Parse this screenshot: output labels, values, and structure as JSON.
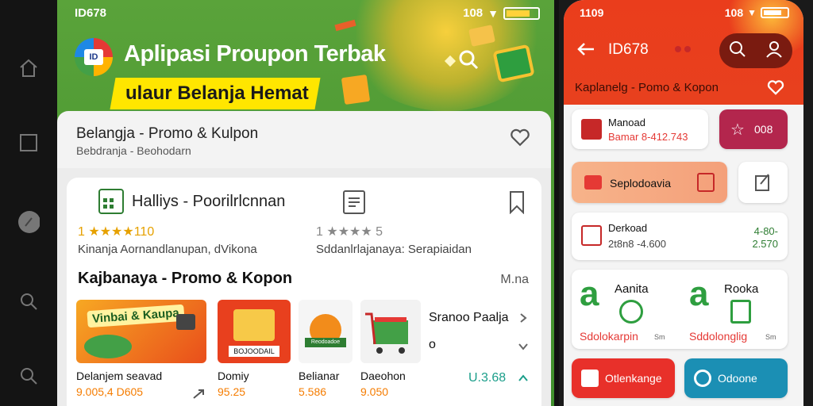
{
  "colors": {
    "green": "#4a9a33",
    "yellow": "#ffe600",
    "red": "#e8401e",
    "orange": "#f57c00",
    "teal": "#1b9e8a"
  },
  "rail": {
    "icons": [
      "home-icon",
      "square-icon",
      "circle-icon",
      "search-icon",
      "search-icon"
    ]
  },
  "phone1": {
    "status_left": "ID678",
    "status_right": "108",
    "title": "Aplipasi Proupon Terbak",
    "banner": "ulaur Belanja Hemat",
    "card": {
      "title": "Belangja - Promo & Kulpon",
      "subtitle": "Bebdranja - Beohodarn"
    },
    "row_title": "Halliys - Poorilrlcnnan",
    "rating_left": "1 ★★★★110",
    "rating_right": "1 ★★★★ 5",
    "sub_left": "Kinanja Aornandlanupan, dVikona",
    "sub_right": "Sddanlrlajanaya: Serapiaidan",
    "section_title": "Kajbanaya - Promo & Kopon",
    "section_more": "M.na",
    "products": [
      {
        "name": "Delanjem seavad",
        "price": "9.005,4 D605",
        "img_text": "Vinbai & Kaupa"
      },
      {
        "name": "Domiy",
        "price": "95.25",
        "img_text": "BOJOODAIL"
      },
      {
        "name": "Belianar",
        "price": "5.586",
        "img_text": "Reodoadoe"
      },
      {
        "name": "Daeohon",
        "price": "9.050",
        "img_text": ""
      }
    ],
    "side": {
      "line1": "Sranoo Paalja",
      "line2": "o",
      "price": "U.3.68"
    }
  },
  "phone2": {
    "status_left": "1109",
    "status_right": "108",
    "title": "ID678",
    "subtitle": "Kaplanelg - Pomo & Kopon",
    "card1": {
      "title": "Manoad",
      "sub": "Bamar 8-412.743"
    },
    "pill_value": "008",
    "promo_bar": "Seplodoavia",
    "card2": {
      "title": "Derkoad",
      "sub": "2t8n8 -4.600",
      "val1": "4-80-",
      "val2": "2.570"
    },
    "grid": [
      {
        "letter": "a",
        "label": "Aanita",
        "sub": "Sdolokarpin",
        "meta": "Sm"
      },
      {
        "letter": "a",
        "label": "Rooka",
        "sub": "Sddolonglig",
        "meta": "Sm"
      }
    ],
    "btn_left": "Otlenkange",
    "btn_right": "Odoone"
  }
}
